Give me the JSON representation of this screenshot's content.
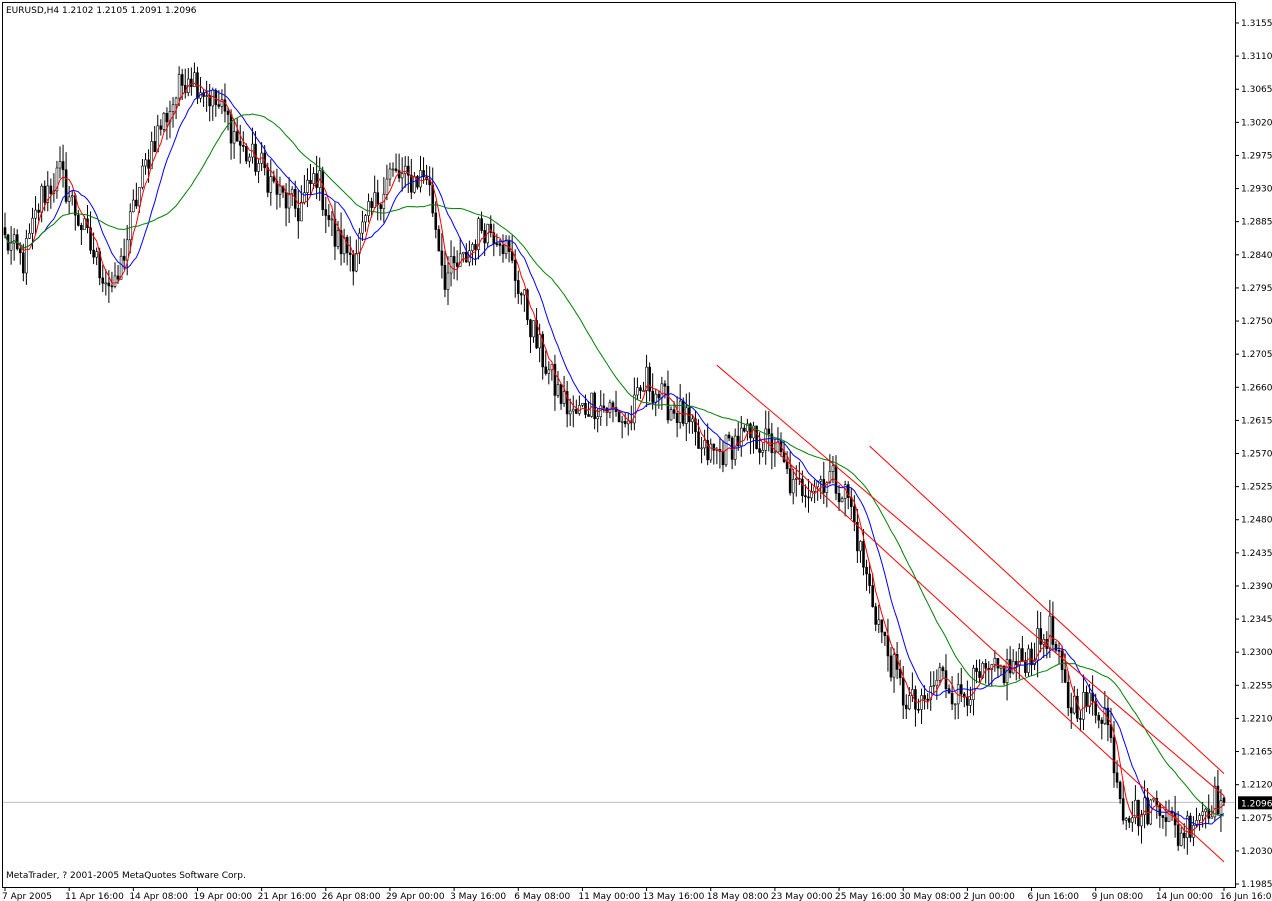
{
  "window": {
    "title": "EURUSD,H4  1.2102 1.2105 1.2091 1.2096",
    "copyright": "MetaTrader, ? 2001-2005 MetaQuotes Software Corp."
  },
  "colors": {
    "background": "#ffffff",
    "candle": "#000000",
    "ma_fast": "#ff0000",
    "ma_mid": "#0000ff",
    "ma_slow": "#008000",
    "channel": "#ff0000",
    "current_price_line": "#c0c0c0",
    "price_label_bg": "#000000"
  },
  "chart_data": {
    "type": "candlestick",
    "symbol": "EURUSD",
    "timeframe": "H4",
    "ohlc_last": {
      "open": 1.2102,
      "high": 1.2105,
      "low": 1.2091,
      "close": 1.2096
    },
    "current_price": 1.2096,
    "current_price_label": "1.2096",
    "ylim": [
      1.1985,
      1.3155
    ],
    "y_ticks": [
      "1.3155",
      "1.3110",
      "1.3065",
      "1.3020",
      "1.2975",
      "1.2930",
      "1.2885",
      "1.2840",
      "1.2795",
      "1.2750",
      "1.2705",
      "1.2660",
      "1.2615",
      "1.2570",
      "1.2525",
      "1.2480",
      "1.2435",
      "1.2390",
      "1.2345",
      "1.2300",
      "1.2255",
      "1.2210",
      "1.2165",
      "1.2120",
      "1.2075",
      "1.2030",
      "1.1985"
    ],
    "x_ticks": [
      "7 Apr 2005",
      "11 Apr 16:00",
      "14 Apr 08:00",
      "19 Apr 00:00",
      "21 Apr 16:00",
      "26 Apr 08:00",
      "29 Apr 00:00",
      "3 May 16:00",
      "6 May 08:00",
      "11 May 00:00",
      "13 May 16:00",
      "18 May 08:00",
      "23 May 00:00",
      "25 May 16:00",
      "30 May 08:00",
      "2 Jun 00:00",
      "6 Jun 16:00",
      "9 Jun 08:00",
      "14 Jun 00:00",
      "16 Jun 16:00"
    ],
    "close_anchors": [
      [
        0,
        1.286
      ],
      [
        6,
        1.283
      ],
      [
        12,
        1.292
      ],
      [
        18,
        1.295
      ],
      [
        24,
        1.289
      ],
      [
        30,
        1.283
      ],
      [
        36,
        1.279
      ],
      [
        42,
        1.29
      ],
      [
        48,
        1.299
      ],
      [
        54,
        1.304
      ],
      [
        60,
        1.309
      ],
      [
        66,
        1.306
      ],
      [
        72,
        1.303
      ],
      [
        78,
        1.298
      ],
      [
        84,
        1.296
      ],
      [
        90,
        1.292
      ],
      [
        96,
        1.29
      ],
      [
        102,
        1.295
      ],
      [
        108,
        1.286
      ],
      [
        114,
        1.284
      ],
      [
        120,
        1.29
      ],
      [
        126,
        1.295
      ],
      [
        132,
        1.294
      ],
      [
        138,
        1.295
      ],
      [
        144,
        1.281
      ],
      [
        150,
        1.283
      ],
      [
        156,
        1.288
      ],
      [
        162,
        1.287
      ],
      [
        168,
        1.28
      ],
      [
        174,
        1.272
      ],
      [
        180,
        1.266
      ],
      [
        186,
        1.262
      ],
      [
        192,
        1.264
      ],
      [
        198,
        1.263
      ],
      [
        204,
        1.261
      ],
      [
        210,
        1.267
      ],
      [
        216,
        1.264
      ],
      [
        222,
        1.262
      ],
      [
        228,
        1.257
      ],
      [
        234,
        1.257
      ],
      [
        240,
        1.259
      ],
      [
        246,
        1.259
      ],
      [
        252,
        1.258
      ],
      [
        258,
        1.252
      ],
      [
        264,
        1.253
      ],
      [
        270,
        1.254
      ],
      [
        276,
        1.251
      ],
      [
        282,
        1.24
      ],
      [
        288,
        1.231
      ],
      [
        294,
        1.224
      ],
      [
        300,
        1.222
      ],
      [
        306,
        1.227
      ],
      [
        312,
        1.224
      ],
      [
        318,
        1.226
      ],
      [
        324,
        1.227
      ],
      [
        330,
        1.228
      ],
      [
        336,
        1.23
      ],
      [
        342,
        1.233
      ],
      [
        348,
        1.223
      ],
      [
        354,
        1.223
      ],
      [
        360,
        1.222
      ],
      [
        366,
        1.209
      ],
      [
        372,
        1.208
      ],
      [
        378,
        1.21
      ],
      [
        384,
        1.205
      ],
      [
        390,
        1.208
      ],
      [
        396,
        1.21
      ],
      [
        399,
        1.2096
      ]
    ],
    "candle_count": 400,
    "moving_averages": [
      {
        "color": "red",
        "period": 5
      },
      {
        "color": "blue",
        "period": 13
      },
      {
        "color": "green",
        "period": 34
      }
    ],
    "channel_lines": [
      {
        "from": [
          233,
          1.269
        ],
        "to": [
          399,
          1.2105
        ]
      },
      {
        "from": [
          248,
          1.259
        ],
        "to": [
          399,
          1.2015
        ]
      },
      {
        "from": [
          283,
          1.258
        ],
        "to": [
          399,
          1.2135
        ]
      }
    ],
    "grid": false,
    "legend": "none"
  }
}
